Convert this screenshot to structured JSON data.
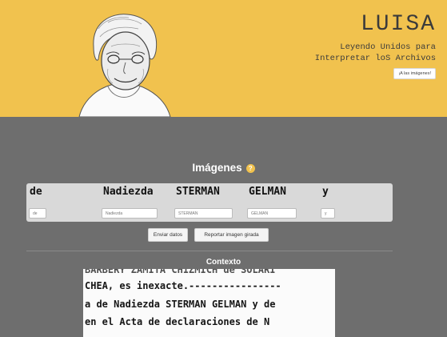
{
  "header": {
    "title": "LUISA",
    "subtitle_line1": "Leyendo Unidos para",
    "subtitle_line2": "Interpretar loS Archivos",
    "cta_label": "¡A las imágenes!"
  },
  "section": {
    "title": "Imágenes",
    "help_symbol": "?"
  },
  "words": [
    {
      "image_text": "de",
      "input_value": "de"
    },
    {
      "image_text": "Nadiezda",
      "input_value": "Nadiezda"
    },
    {
      "image_text": "STERMAN",
      "input_value": "STERMAN"
    },
    {
      "image_text": "GELMAN",
      "input_value": "GELMAN"
    },
    {
      "image_text": "y",
      "input_value": "y"
    }
  ],
  "actions": {
    "submit_label": "Enviar datos",
    "report_label": "Reportar imagen girada"
  },
  "context": {
    "title": "Contexto",
    "lines": [
      "BARBERY ZAMITA CHIZMICH de SOLARI",
      "CHEA, es inexacte.----------------",
      "a de Nadiezda STERMAN GELMAN y de",
      "en el Acta de declaraciones de N"
    ]
  },
  "colors": {
    "header_bg": "#f1c24e",
    "page_bg": "#6e6e6e",
    "panel_bg": "#d9d9d9"
  }
}
